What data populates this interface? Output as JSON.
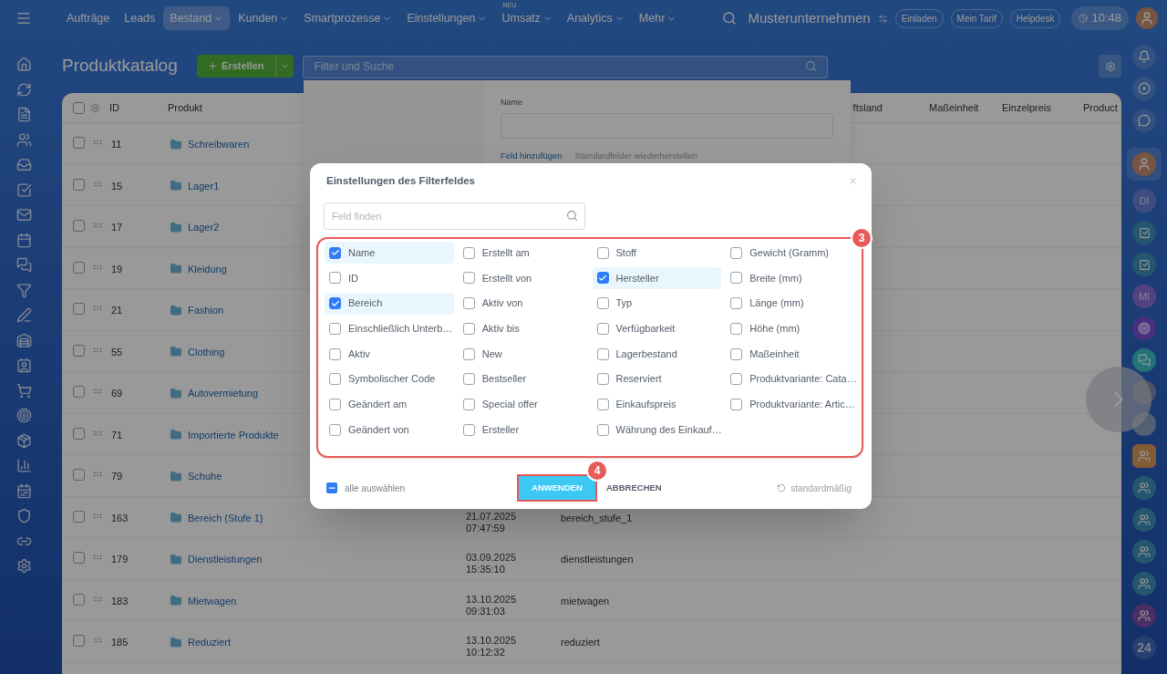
{
  "topbar": {
    "nav": [
      {
        "label": "Aufträge",
        "selected": false,
        "menu": false
      },
      {
        "label": "Leads",
        "selected": false,
        "menu": false
      },
      {
        "label": "Bestand",
        "selected": true,
        "menu": true
      },
      {
        "label": "Kunden",
        "selected": false,
        "menu": true
      },
      {
        "label": "Smartprozesse",
        "selected": false,
        "menu": true
      },
      {
        "label": "Einstellungen",
        "selected": false,
        "menu": true
      },
      {
        "label": "Umsatz",
        "selected": false,
        "menu": true,
        "badge": "NEU"
      },
      {
        "label": "Analytics",
        "selected": false,
        "menu": true
      },
      {
        "label": "Mehr",
        "selected": false,
        "menu": true
      }
    ],
    "company": "Musterunternehmen",
    "buttons": [
      "Einladen",
      "Mein Tarif",
      "Helpdesk"
    ],
    "time": "10:48"
  },
  "right_sidebar": {
    "initials": [
      "DI",
      "MI"
    ],
    "counter": "24"
  },
  "page": {
    "title": "Produktkatalog",
    "create_button": "Erstellen",
    "search_placeholder": "Filter und Suche"
  },
  "table": {
    "header_checked": false,
    "columns": [
      "ID",
      "Produkt",
      "ftsland",
      "Maßeinheit",
      "Einzelpreis",
      "Product"
    ],
    "rows": [
      {
        "id": "11",
        "name": "Schreibwaren",
        "selected": false
      },
      {
        "id": "15",
        "name": "Lager1",
        "selected": false
      },
      {
        "id": "17",
        "name": "Lager2",
        "selected": false
      },
      {
        "id": "19",
        "name": "Kleidung",
        "selected": false
      },
      {
        "id": "21",
        "name": "Fashion",
        "selected": false
      },
      {
        "id": "55",
        "name": "Clothing",
        "selected": false
      },
      {
        "id": "69",
        "name": "Autovermietung",
        "selected": false
      },
      {
        "id": "71",
        "name": "Importierte Produkte",
        "selected": false
      },
      {
        "id": "79",
        "name": "Schuhe",
        "selected": false
      },
      {
        "id": "163",
        "name": "Bereich (Stufe 1)",
        "selected": false,
        "date": "21.07.2025",
        "time": "07:47:59",
        "code": "bereich_stufe_1"
      },
      {
        "id": "179",
        "name": "Dienstleistungen",
        "selected": false,
        "date": "03.09.2025",
        "time": "15:35:10",
        "code": "dienstleistungen"
      },
      {
        "id": "183",
        "name": "Mietwagen",
        "selected": false,
        "date": "13.10.2025",
        "time": "09:31:03",
        "code": "mietwagen"
      },
      {
        "id": "185",
        "name": "Reduziert",
        "selected": false,
        "date": "13.10.2025",
        "time": "10:12:32",
        "code": "reduziert"
      }
    ]
  },
  "filter_popup": {
    "field_label": "Name",
    "add_link": "Feld hinzufügen",
    "restore_link": "Standardfelder wiederherstellen"
  },
  "modal": {
    "title": "Einstellungen des Filterfeldes",
    "search_placeholder": "Feld finden",
    "fields": [
      {
        "label": "Name",
        "checked": true
      },
      {
        "label": "Erstellt am",
        "checked": false
      },
      {
        "label": "Stoff",
        "checked": false
      },
      {
        "label": "Gewicht (Gramm)",
        "checked": false
      },
      {
        "label": "ID",
        "checked": false
      },
      {
        "label": "Erstellt von",
        "checked": false
      },
      {
        "label": "Hersteller",
        "checked": true
      },
      {
        "label": "Breite (mm)",
        "checked": false
      },
      {
        "label": "Bereich",
        "checked": true
      },
      {
        "label": "Aktiv von",
        "checked": false
      },
      {
        "label": "Typ",
        "checked": false
      },
      {
        "label": "Länge (mm)",
        "checked": false
      },
      {
        "label": "Einschließlich Unterb…",
        "checked": false
      },
      {
        "label": "Aktiv bis",
        "checked": false
      },
      {
        "label": "Verfügbarkeit",
        "checked": false
      },
      {
        "label": "Höhe (mm)",
        "checked": false
      },
      {
        "label": "Aktiv",
        "checked": false
      },
      {
        "label": "New",
        "checked": false
      },
      {
        "label": "Lagerbestand",
        "checked": false
      },
      {
        "label": "Maßeinheit",
        "checked": false
      },
      {
        "label": "Symbolischer Code",
        "checked": false
      },
      {
        "label": "Bestseller",
        "checked": false
      },
      {
        "label": "Reserviert",
        "checked": false
      },
      {
        "label": "Produktvariante: Cata…",
        "checked": false
      },
      {
        "label": "Geändert am",
        "checked": false
      },
      {
        "label": "Special offer",
        "checked": false
      },
      {
        "label": "Einkaufspreis",
        "checked": false
      },
      {
        "label": "Produktvariante: Artic…",
        "checked": false
      },
      {
        "label": "Geändert von",
        "checked": false
      },
      {
        "label": "Ersteller",
        "checked": false
      },
      {
        "label": "Währung des Einkauf…",
        "checked": false
      }
    ],
    "select_all": {
      "label": "alle auswählen",
      "indeterminate": true
    },
    "apply_button": "ANWENDEN",
    "cancel_button": "ABBRECHEN",
    "reset_button": "standardmäßig",
    "markers": [
      "3",
      "4"
    ]
  }
}
